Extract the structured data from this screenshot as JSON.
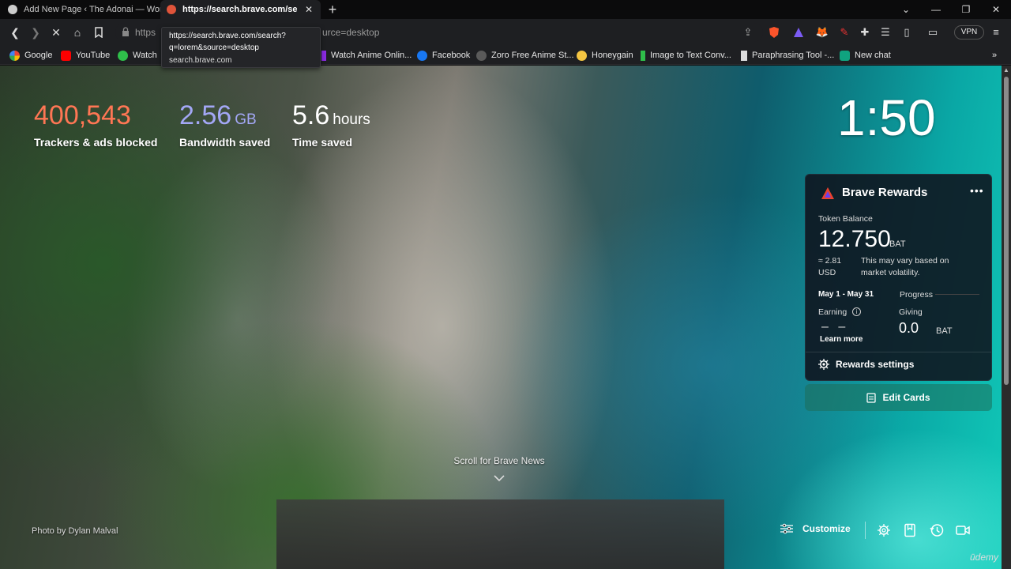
{
  "browser": {
    "tabs": [
      {
        "label": "Add New Page ‹ The Adonai — Word",
        "active": false
      },
      {
        "label": "https://search.brave.com/search?",
        "active": true
      }
    ],
    "address_bar": {
      "prefix": "https",
      "suffix": "urce=desktop"
    },
    "vpn_label": "VPN",
    "hover_tooltip": {
      "line1": "https://search.brave.com/search?",
      "line2": "q=lorem&source=desktop",
      "line3": "search.brave.com"
    },
    "bookmarks": [
      {
        "label": "Google",
        "icon": "google-icon",
        "color": "#ea4335"
      },
      {
        "label": "YouTube",
        "icon": "youtube-icon",
        "color": "#ff0000"
      },
      {
        "label": "Watch",
        "icon": "watch-icon",
        "color": "#2fbf4a"
      },
      {
        "label": "Watch Anime Onlin...",
        "icon": "anime-icon",
        "color": "#8a2be2"
      },
      {
        "label": "Facebook",
        "icon": "facebook-icon",
        "color": "#1877f2"
      },
      {
        "label": "Zoro Free Anime St...",
        "icon": "zoro-icon",
        "color": "#5a5a5a"
      },
      {
        "label": "Honeygain",
        "icon": "honeygain-icon",
        "color": "#f4c542"
      },
      {
        "label": "Image to Text Conv...",
        "icon": "image-to-text-icon",
        "color": "#2fbf4a"
      },
      {
        "label": "Paraphrasing Tool -...",
        "icon": "paraphrase-icon",
        "color": "#dddddd"
      },
      {
        "label": "New chat",
        "icon": "chat-icon",
        "color": "#10a37f"
      }
    ]
  },
  "stats": [
    {
      "value": "400,543",
      "unit": "",
      "label": "Trackers & ads blocked",
      "color": "#ff7654"
    },
    {
      "value": "2.56",
      "unit": "GB",
      "label": "Bandwidth saved",
      "color": "#a3a7f5"
    },
    {
      "value": "5.6",
      "unit": "hours",
      "label": "Time saved",
      "color": "#ffffff"
    }
  ],
  "clock": "1:50",
  "rewards": {
    "title": "Brave Rewards",
    "token_balance_label": "Token Balance",
    "balance": "12.750",
    "balance_unit": "BAT",
    "usd_value": "≈ 2.81 USD",
    "volatility_note": "This may vary based on market volatility.",
    "period": "May 1 - May 31",
    "progress_label": "Progress",
    "earning_label": "Earning",
    "earning_value": "– –",
    "learn_more": "Learn more",
    "giving_label": "Giving",
    "giving_value": "0.0",
    "giving_unit": "BAT",
    "settings_label": "Rewards settings"
  },
  "edit_cards_label": "Edit Cards",
  "scroll_news_label": "Scroll for Brave News",
  "photo_credit": "Photo by Dylan Malval",
  "customize_label": "Customize",
  "watermark": "ūdemy"
}
